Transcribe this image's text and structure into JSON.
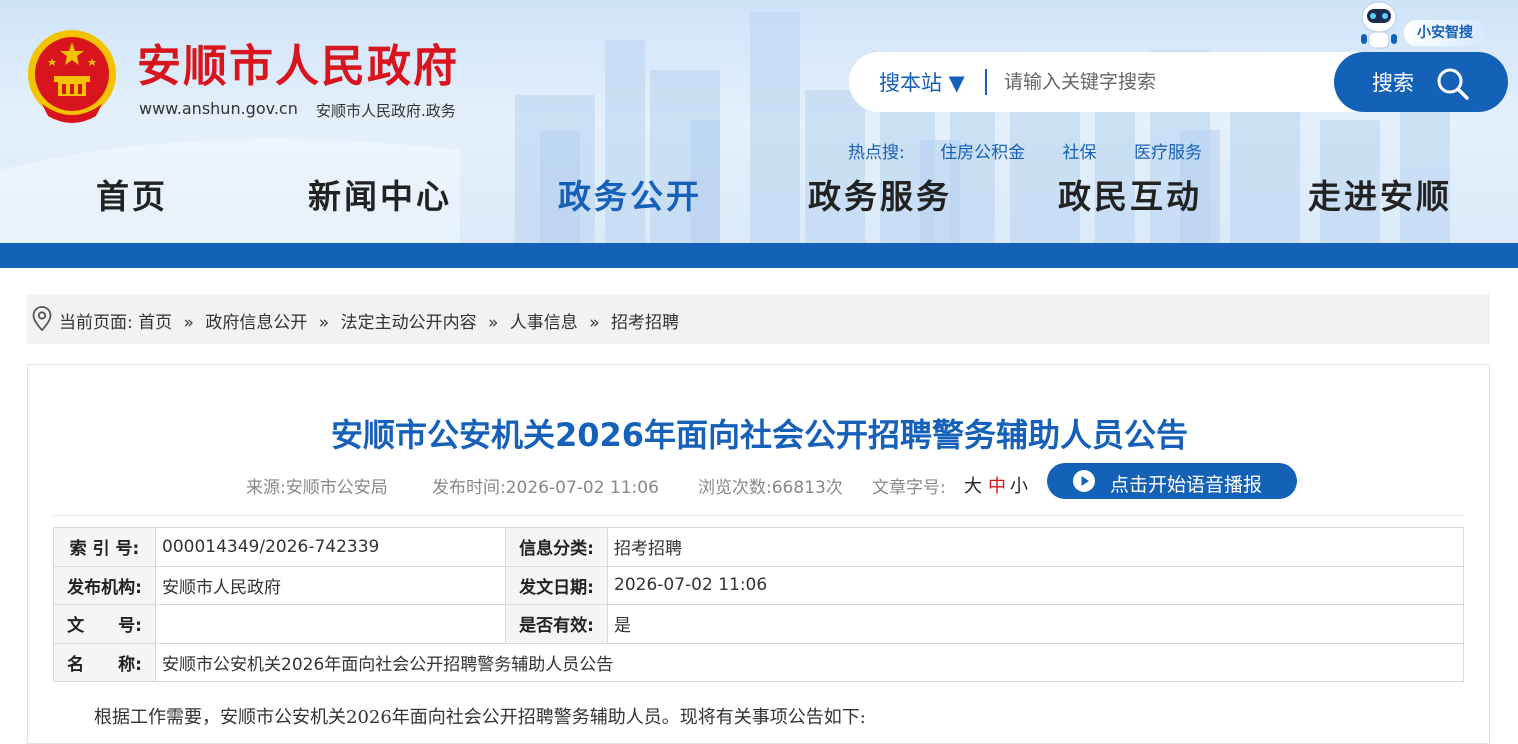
{
  "header": {
    "site_title": "安顺市人民政府",
    "site_url": "www.anshun.gov.cn",
    "site_subtitle": "安顺市人民政府.政务",
    "assistant_badge": "小安智搜",
    "search": {
      "scope_label": "搜本站 ▼",
      "placeholder": "请输入关键字搜索",
      "button_label": "搜索"
    },
    "hot": {
      "label": "热点搜:",
      "items": [
        "住房公积金",
        "社保",
        "医疗服务"
      ]
    },
    "nav": [
      {
        "label": "首页",
        "active": false
      },
      {
        "label": "新闻中心",
        "active": false
      },
      {
        "label": "政务公开",
        "active": true
      },
      {
        "label": "政务服务",
        "active": false
      },
      {
        "label": "政民互动",
        "active": false
      },
      {
        "label": "走进安顺",
        "active": false
      }
    ]
  },
  "breadcrumb": {
    "prefix": "当前页面:",
    "separator": "»",
    "items": [
      "首页",
      "政府信息公开",
      "法定主动公开内容",
      "人事信息",
      "招考招聘"
    ]
  },
  "article": {
    "title": "安顺市公安机关2026年面向社会公开招聘警务辅助人员公告",
    "meta": {
      "source": "来源:安顺市公安局",
      "publish_time": "发布时间:2026-07-02 11:06",
      "views": "浏览次数:66813次",
      "font_size_label": "文章字号:",
      "font_sizes": [
        "大",
        "中",
        "小"
      ]
    },
    "audio_button": "点击开始语音播报",
    "info": {
      "index_label": "索 引 号:",
      "index_value": "000014349/2026-742339",
      "category_label": "信息分类:",
      "category_value": "招考招聘",
      "publisher_label": "发布机构:",
      "publisher_value": "安顺市人民政府",
      "date_label": "发文日期:",
      "date_value": "2026-07-02 11:06",
      "docno_label": "文　　号:",
      "docno_value": "",
      "valid_label": "是否有效:",
      "valid_value": "是",
      "name_label": "名　　称:",
      "name_value": "安顺市公安机关2026年面向社会公开招聘警务辅助人员公告"
    },
    "body_first_line": "根据工作需要，安顺市公安机关2026年面向社会公开招聘警务辅助人员。现将有关事项公告如下:"
  },
  "colors": {
    "brand_blue": "#1462b8",
    "title_red": "#d8141c",
    "font_mid_red": "#d8141c"
  }
}
